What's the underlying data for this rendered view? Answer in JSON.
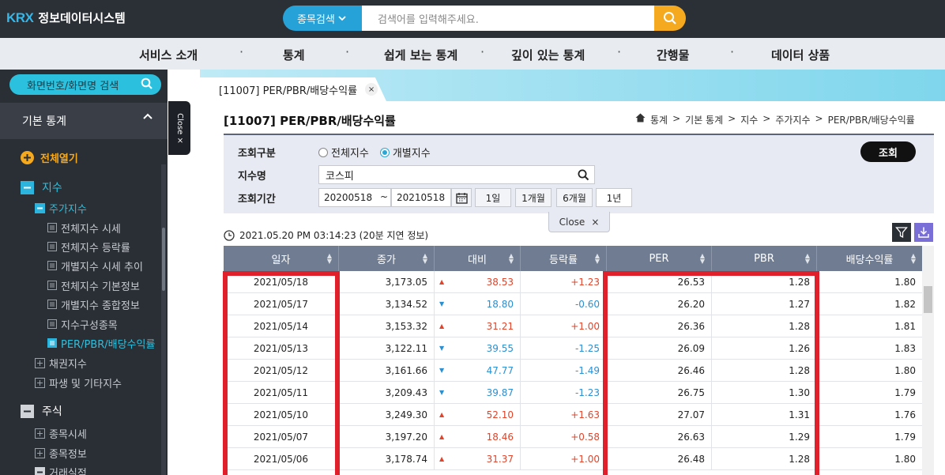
{
  "header": {
    "logo_mark": "KRX",
    "logo_text": "정보데이터시스템",
    "search_category": "종목검색",
    "search_placeholder": "검색어를 입력해주세요."
  },
  "nav": [
    "서비스 소개",
    "통계",
    "쉽게 보는 통계",
    "깊이 있는 통계",
    "간행물",
    "데이터 상품"
  ],
  "sidebar": {
    "search_placeholder": "화면번호/화면명 검색",
    "section": "기본 통계",
    "expand_all": "전체열기",
    "close_label": "Close",
    "tree": [
      {
        "label": "지수",
        "level": 1,
        "state": "open",
        "active": true
      },
      {
        "label": "주가지수",
        "level": 2,
        "state": "open",
        "active": true
      },
      {
        "label": "전체지수 시세",
        "level": 3
      },
      {
        "label": "전체지수 등락률",
        "level": 3
      },
      {
        "label": "개별지수 시세 추이",
        "level": 3
      },
      {
        "label": "전체지수 기본정보",
        "level": 3
      },
      {
        "label": "개별지수 종합정보",
        "level": 3
      },
      {
        "label": "지수구성종목",
        "level": 3
      },
      {
        "label": "PER/PBR/배당수익률",
        "level": 3,
        "active": true
      },
      {
        "label": "채권지수",
        "level": 2,
        "state": "closed"
      },
      {
        "label": "파생 및 기타지수",
        "level": 2,
        "state": "closed"
      },
      {
        "label": "주식",
        "level": 1,
        "state": "open"
      },
      {
        "label": "종목시세",
        "level": 2,
        "state": "closed"
      },
      {
        "label": "종목정보",
        "level": 2,
        "state": "closed"
      },
      {
        "label": "거래실적",
        "level": 2,
        "state": "open"
      }
    ]
  },
  "tab": {
    "label": "[11007] PER/PBR/배당수익률",
    "close": "×"
  },
  "page": {
    "title": "[11007] PER/PBR/배당수익률",
    "breadcrumb": [
      "통계",
      "기본 통계",
      "지수",
      "주가지수",
      "PER/PBR/배당수익률"
    ]
  },
  "query": {
    "type_label": "조회구분",
    "type_options": [
      "전체지수",
      "개별지수"
    ],
    "type_selected": "개별지수",
    "index_label": "지수명",
    "index_value": "코스피",
    "period_label": "조회기간",
    "start_date": "20200518",
    "end_date": "20210518",
    "tilde": "~",
    "periods": [
      "1일",
      "1개월",
      "6개월",
      "1년"
    ],
    "period_selected": "1년",
    "submit": "조회",
    "close": "Close"
  },
  "timestamp": "2021.05.20 PM 03:14:23 (20분 지연 정보)",
  "table": {
    "columns": [
      "일자",
      "종가",
      "대비",
      "등락률",
      "PER",
      "PBR",
      "배당수익률"
    ],
    "rows": [
      {
        "date": "2021/05/18",
        "close": "3,173.05",
        "dir": "up",
        "change": "38.53",
        "rate": "+1.23",
        "per": "26.53",
        "pbr": "1.28",
        "dy": "1.80"
      },
      {
        "date": "2021/05/17",
        "close": "3,134.52",
        "dir": "down",
        "change": "18.80",
        "rate": "-0.60",
        "per": "26.20",
        "pbr": "1.27",
        "dy": "1.82"
      },
      {
        "date": "2021/05/14",
        "close": "3,153.32",
        "dir": "up",
        "change": "31.21",
        "rate": "+1.00",
        "per": "26.36",
        "pbr": "1.28",
        "dy": "1.81"
      },
      {
        "date": "2021/05/13",
        "close": "3,122.11",
        "dir": "down",
        "change": "39.55",
        "rate": "-1.25",
        "per": "26.09",
        "pbr": "1.26",
        "dy": "1.83"
      },
      {
        "date": "2021/05/12",
        "close": "3,161.66",
        "dir": "down",
        "change": "47.77",
        "rate": "-1.49",
        "per": "26.46",
        "pbr": "1.28",
        "dy": "1.80"
      },
      {
        "date": "2021/05/11",
        "close": "3,209.43",
        "dir": "down",
        "change": "39.87",
        "rate": "-1.23",
        "per": "26.75",
        "pbr": "1.30",
        "dy": "1.79"
      },
      {
        "date": "2021/05/10",
        "close": "3,249.30",
        "dir": "up",
        "change": "52.10",
        "rate": "+1.63",
        "per": "27.07",
        "pbr": "1.31",
        "dy": "1.76"
      },
      {
        "date": "2021/05/07",
        "close": "3,197.20",
        "dir": "up",
        "change": "18.46",
        "rate": "+0.58",
        "per": "26.63",
        "pbr": "1.29",
        "dy": "1.79"
      },
      {
        "date": "2021/05/06",
        "close": "3,178.74",
        "dir": "up",
        "change": "31.37",
        "rate": "+1.00",
        "per": "26.48",
        "pbr": "1.28",
        "dy": "1.80"
      }
    ]
  },
  "colors": {
    "up": "#e0452b",
    "down": "#2b8fd0",
    "accent": "#29a8d6",
    "highlight": "#e0202a"
  }
}
